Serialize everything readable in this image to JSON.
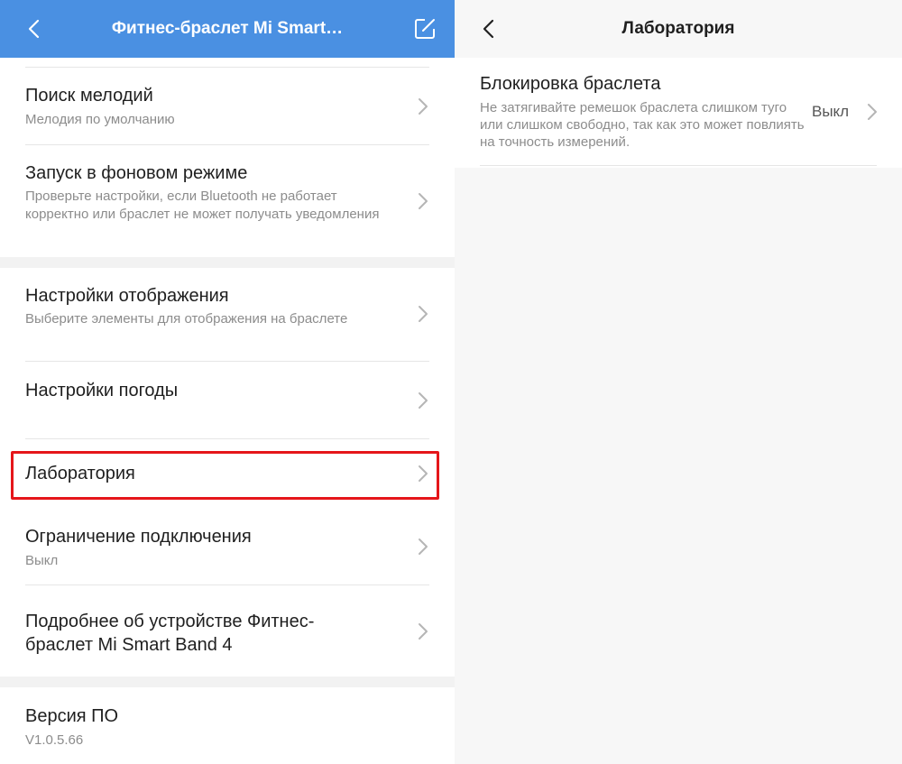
{
  "left": {
    "header_title": "Фитнес-браслет Mi Smart…",
    "icons": {
      "back": "chevron-left-icon",
      "edit": "edit-icon"
    },
    "items": [
      {
        "title": "Поиск мелодий",
        "subtitle": "Мелодия по умолчанию"
      },
      {
        "title": "Запуск в фоновом режиме",
        "subtitle": "Проверьте настройки, если Bluetooth не работает корректно или браслет не может получать уведомления"
      },
      {
        "title": "Настройки отображения",
        "subtitle": "Выберите элементы для отображения на браслете"
      },
      {
        "title": "Настройки погоды",
        "subtitle": ""
      },
      {
        "title": "Лаборатория",
        "subtitle": ""
      },
      {
        "title": "Ограничение подключения",
        "subtitle": "Выкл"
      },
      {
        "title": "Подробнее об устройстве Фитнес-браслет Mi Smart Band 4",
        "subtitle": ""
      },
      {
        "title": "Версия ПО",
        "subtitle": "V1.0.5.66"
      }
    ],
    "highlight_color": "#e5161a",
    "header_color": "#4a90e2"
  },
  "right": {
    "header_title": "Лаборатория",
    "icons": {
      "back": "chevron-left-icon"
    },
    "item": {
      "title": "Блокировка браслета",
      "subtitle": "Не затягивайте ремешок браслета слишком туго или слишком свободно, так как это может повлиять на точность измерений.",
      "status": "Выкл"
    }
  }
}
